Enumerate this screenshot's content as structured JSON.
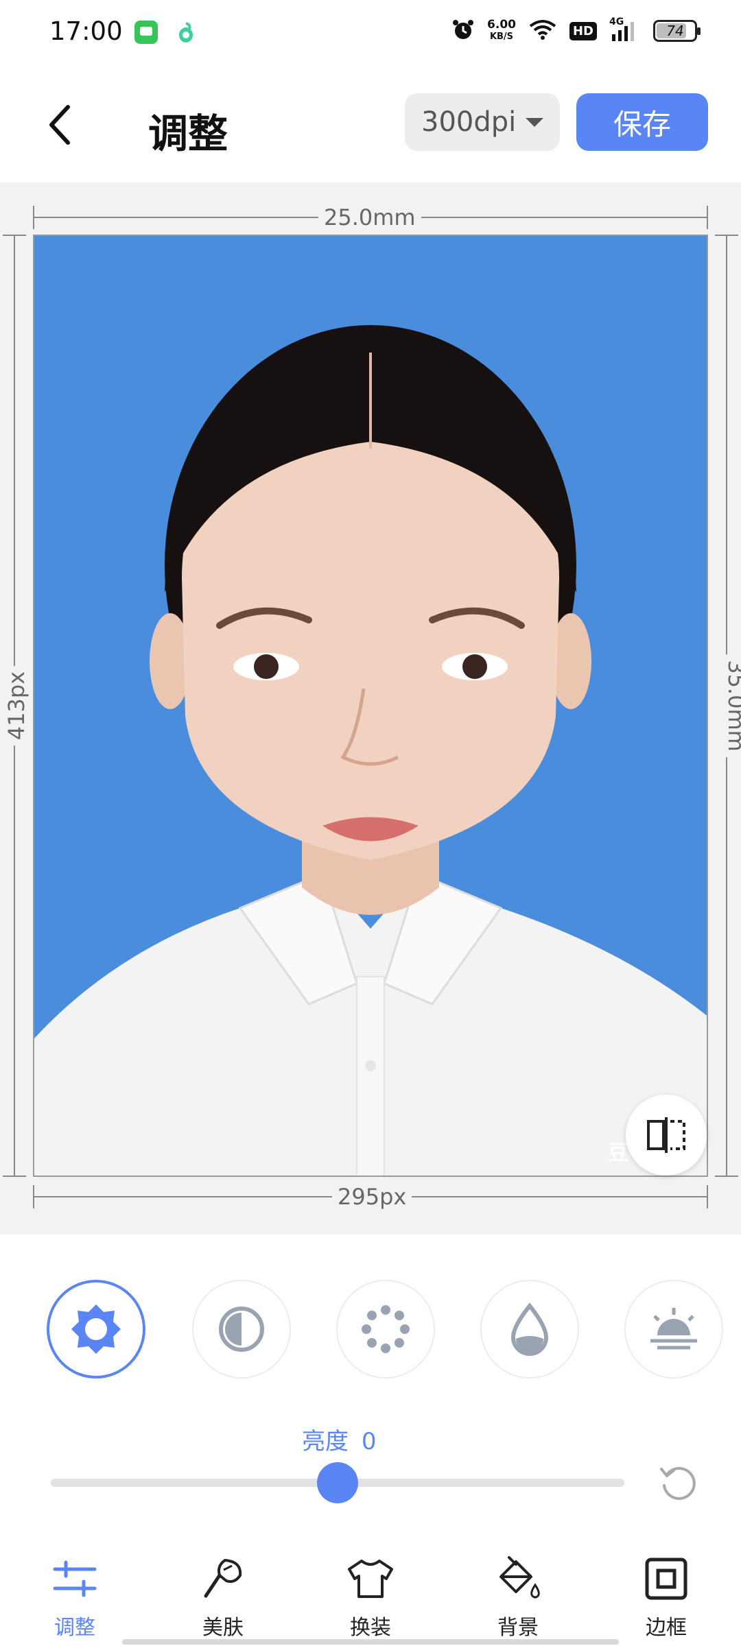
{
  "status_bar": {
    "time": "17:00",
    "net_speed_value": "6.00",
    "net_speed_unit": "KB/S",
    "hd_label": "HD",
    "network_label": "4G",
    "battery_level": "74"
  },
  "header": {
    "title": "调整",
    "dpi_selected": "300dpi",
    "save_label": "保存"
  },
  "dimensions": {
    "width_mm": "25.0mm",
    "height_mm": "35.0mm",
    "width_px": "295px",
    "height_px": "413px"
  },
  "photo": {
    "background_color": "#4a8ddc",
    "watermark_text": "豆"
  },
  "tools": [
    {
      "icon": "brightness-icon",
      "active": true
    },
    {
      "icon": "contrast-icon",
      "active": false
    },
    {
      "icon": "saturation-icon",
      "active": false
    },
    {
      "icon": "tint-icon",
      "active": false
    },
    {
      "icon": "exposure-icon",
      "active": false
    }
  ],
  "slider": {
    "label": "亮度",
    "value": "0",
    "position_fraction": 0.5
  },
  "bottom_nav": [
    {
      "label": "调整",
      "icon": "sliders-icon",
      "active": true
    },
    {
      "label": "美肤",
      "icon": "skin-brush-icon",
      "active": false
    },
    {
      "label": "换装",
      "icon": "shirt-icon",
      "active": false
    },
    {
      "label": "背景",
      "icon": "paint-bucket-icon",
      "active": false
    },
    {
      "label": "边框",
      "icon": "frame-icon",
      "active": false
    }
  ],
  "colors": {
    "accent": "#5a86f5",
    "photo_bg": "#4a8ddc"
  }
}
